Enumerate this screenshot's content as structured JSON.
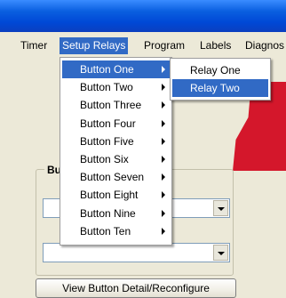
{
  "menubar": {
    "items": [
      "Timer",
      "Setup Relays",
      "Program",
      "Labels",
      "Diagnos"
    ]
  },
  "dropdown": {
    "items": [
      "Button One",
      "Button Two",
      "Button Three",
      "Button Four",
      "Button Five",
      "Button Six",
      "Button Seven",
      "Button Eight",
      "Button Nine",
      "Button Ten"
    ]
  },
  "submenu": {
    "items": [
      "Relay One",
      "Relay Two"
    ]
  },
  "group": {
    "title": "Bu"
  },
  "buttons": {
    "view_detail": "View Button Detail/Reconfigure"
  },
  "colors": {
    "highlight": "#316ac5",
    "titlebar": "#0a5fe0",
    "accent_red": "#d4172b"
  }
}
